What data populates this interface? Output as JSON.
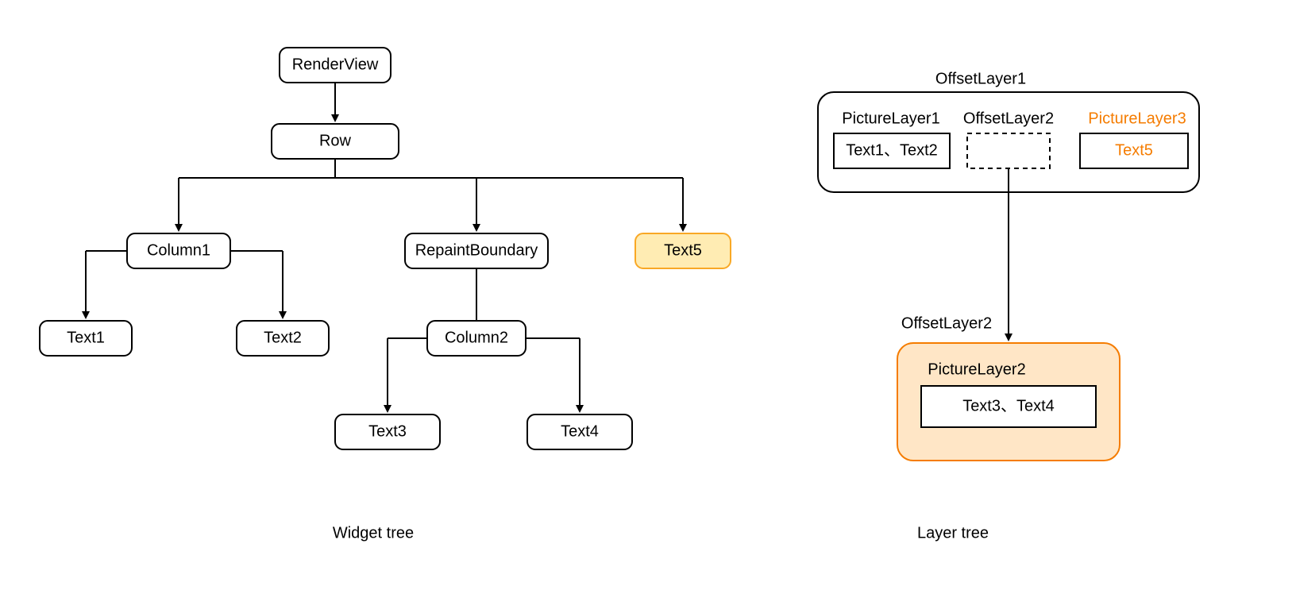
{
  "colors": {
    "highlight_fill": "#ffecb3",
    "highlight_stroke": "#f9a825",
    "orange_fill": "#ffe6c6",
    "orange_stroke": "#f57c00",
    "orange_text": "#f57c00",
    "stroke": "#000000"
  },
  "widget_tree": {
    "caption": "Widget tree",
    "nodes": {
      "renderView": "RenderView",
      "row": "Row",
      "column1": "Column1",
      "repaintBoundary": "RepaintBoundary",
      "text5": "Text5",
      "text1": "Text1",
      "text2": "Text2",
      "column2": "Column2",
      "text3": "Text3",
      "text4": "Text4"
    }
  },
  "layer_tree": {
    "caption": "Layer tree",
    "offsetLayer1": {
      "title": "OffsetLayer1",
      "pictureLayer1": {
        "title": "PictureLayer1",
        "content": "Text1、Text2"
      },
      "offsetLayer2Placeholder": {
        "title": "OffsetLayer2"
      },
      "pictureLayer3": {
        "title": "PictureLayer3",
        "content": "Text5"
      }
    },
    "offsetLayer2": {
      "title": "OffsetLayer2",
      "pictureLayer2": {
        "title": "PictureLayer2",
        "content": "Text3、Text4"
      }
    }
  }
}
